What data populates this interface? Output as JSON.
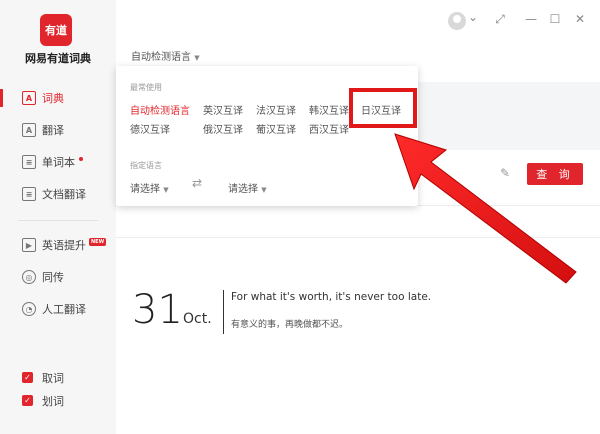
{
  "app": {
    "logo_text": "有道",
    "name": "网易有道词典"
  },
  "sidebar": {
    "items": [
      {
        "label": "词典",
        "icon_glyph": "A",
        "icon": "dictionary-icon",
        "active": true
      },
      {
        "label": "翻译",
        "icon_glyph": "A",
        "icon": "translate-icon"
      },
      {
        "label": "单词本",
        "icon_glyph": "≡",
        "icon": "wordbook-icon",
        "dot": true
      },
      {
        "label": "文档翻译",
        "icon_glyph": "≡",
        "icon": "document-icon"
      },
      {
        "label": "英语提升",
        "icon_glyph": "▶",
        "icon": "play-icon",
        "badge": "NEW"
      },
      {
        "label": "同传",
        "icon_glyph": "◎",
        "icon": "interpret-icon"
      },
      {
        "label": "人工翻译",
        "icon_glyph": "◔",
        "icon": "human-translate-icon"
      }
    ],
    "checks": [
      {
        "label": "取词",
        "checked": true
      },
      {
        "label": "划词",
        "checked": true
      }
    ]
  },
  "titlebar": {
    "chevron": "⌄",
    "mini": "⤢",
    "minimize": "—",
    "maximize": "☐",
    "close": "✕"
  },
  "main": {
    "lang_select": "自动检测语言",
    "query_label": "查 询"
  },
  "dropdown": {
    "frequent_label": "最常使用",
    "options_row1": [
      "自动检测语言",
      "英汉互译",
      "法汉互译",
      "韩汉互译",
      "日汉互译"
    ],
    "options_row2": [
      "德汉互译",
      "俄汉互译",
      "葡汉互译",
      "西汉互译"
    ],
    "specify_label": "指定语言",
    "from_placeholder": "请选择",
    "to_placeholder": "请选择",
    "selected": "自动检测语言",
    "highlighted": "日汉互译"
  },
  "daily": {
    "day": "31",
    "month": "Oct.",
    "quote_en": "For what it's worth, it's never too late.",
    "quote_cn": "有意义的事，再晚做都不迟。"
  },
  "colors": {
    "accent": "#e0262c",
    "annotation": "#e01818"
  }
}
